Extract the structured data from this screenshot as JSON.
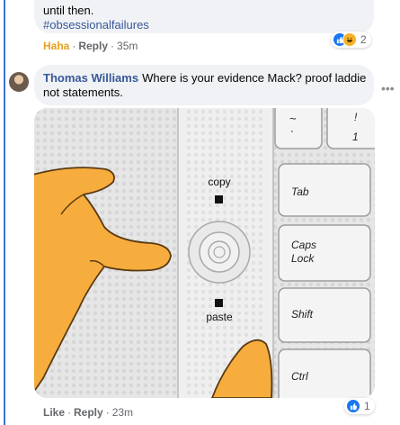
{
  "prev_comment": {
    "line1": "until then.",
    "hashtag": "#obsessionalfailures",
    "reaction_count": "2",
    "meta": {
      "reaction": "Haha",
      "reply": "Reply",
      "time": "35m"
    }
  },
  "comment": {
    "author": "Thomas Williams",
    "text": "Where is your evidence Mack? proof laddie not statements.",
    "more_label": "•••",
    "image": {
      "label_copy": "copy",
      "label_paste": "paste",
      "keys": [
        "Tab",
        "Caps",
        "Lock",
        "Shift",
        "Ctrl"
      ],
      "key_top_left": "~",
      "key_top_left_sub": "`",
      "key_top_right": "!",
      "key_top_right_sub": "1"
    },
    "reaction_count": "1",
    "meta": {
      "like": "Like",
      "reply": "Reply",
      "time": "23m"
    }
  },
  "colors": {
    "link": "#385898",
    "haha": "#e8a11d",
    "like": "#1877f2",
    "thread": "#3d73d6"
  }
}
